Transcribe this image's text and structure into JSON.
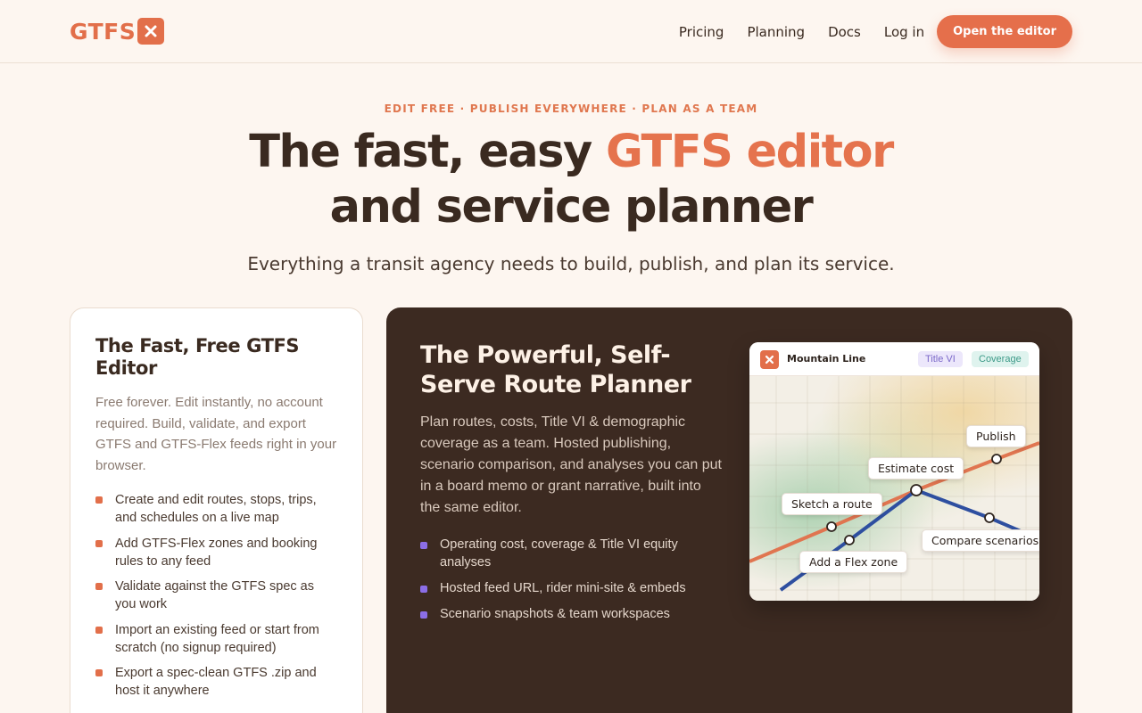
{
  "header": {
    "logo_text": "GTFS",
    "logo_icon": "x-icon",
    "nav": [
      "Pricing",
      "Planning",
      "Docs"
    ],
    "login_label": "Log in",
    "cta_label": "Open the editor"
  },
  "hero": {
    "eyebrow": "EDIT FREE · PUBLISH EVERYWHERE · PLAN AS A TEAM",
    "headline_part1": "The fast, easy ",
    "headline_accent": "GTFS editor",
    "headline_part2": "and service planner",
    "subhead": "Everything a transit agency needs to build, publish, and plan its service."
  },
  "free_card": {
    "title": "The Fast, Free GTFS Editor",
    "description": "Free forever. Edit instantly, no account required. Build, validate, and export GTFS and GTFS-Flex feeds right in your browser.",
    "bullets": [
      "Create and edit routes, stops, trips, and schedules on a live map",
      "Add GTFS-Flex zones and booking rules to any feed",
      "Validate against the GTFS spec as you work",
      "Import an existing feed or start from scratch (no signup required)",
      "Export a spec-clean GTFS .zip and host it anywhere"
    ]
  },
  "planner_card": {
    "title": "The Powerful, Self-Serve Route Planner",
    "description": "Plan routes, costs, Title VI & demographic coverage as a team. Hosted publishing, scenario comparison, and analyses you can put in a board memo or grant narrative, built into the same editor.",
    "bullets": [
      "Operating cost, coverage & Title VI equity analyses",
      "Hosted feed URL, rider mini-site & embeds",
      "Scenario snapshots & team workspaces"
    ]
  },
  "map_preview": {
    "agency": "Mountain Line",
    "pills": [
      "Title VI",
      "Coverage"
    ],
    "labels": {
      "publish": "Publish",
      "estimate": "Estimate cost",
      "sketch": "Sketch a route",
      "compare": "Compare scenarios",
      "flex": "Add a Flex zone"
    }
  },
  "colors": {
    "accent": "#e5734d",
    "background": "#fdf6f0",
    "dark_card": "#3c2a21",
    "bullet_light": "#e26f4a",
    "bullet_dark": "#8b6ee6",
    "route_orange": "#e07550",
    "route_blue": "#2e4fa0"
  }
}
